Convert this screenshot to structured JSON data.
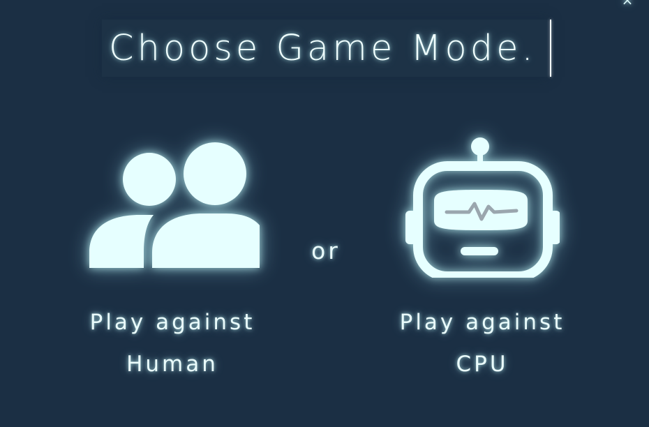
{
  "window": {
    "close_label": "×"
  },
  "title": {
    "text": "Choose Game Mode."
  },
  "modes": [
    {
      "id": "human",
      "label_line1": "Play against",
      "label_line2": "Human",
      "icon": "users-icon"
    },
    {
      "id": "cpu",
      "label_line1": "Play against",
      "label_line2": "CPU",
      "icon": "robot-icon"
    }
  ],
  "separator": {
    "text": "or"
  },
  "colors": {
    "background": "#1b2f44",
    "title_background": "#1d3246",
    "glow": "#e6ffff"
  }
}
